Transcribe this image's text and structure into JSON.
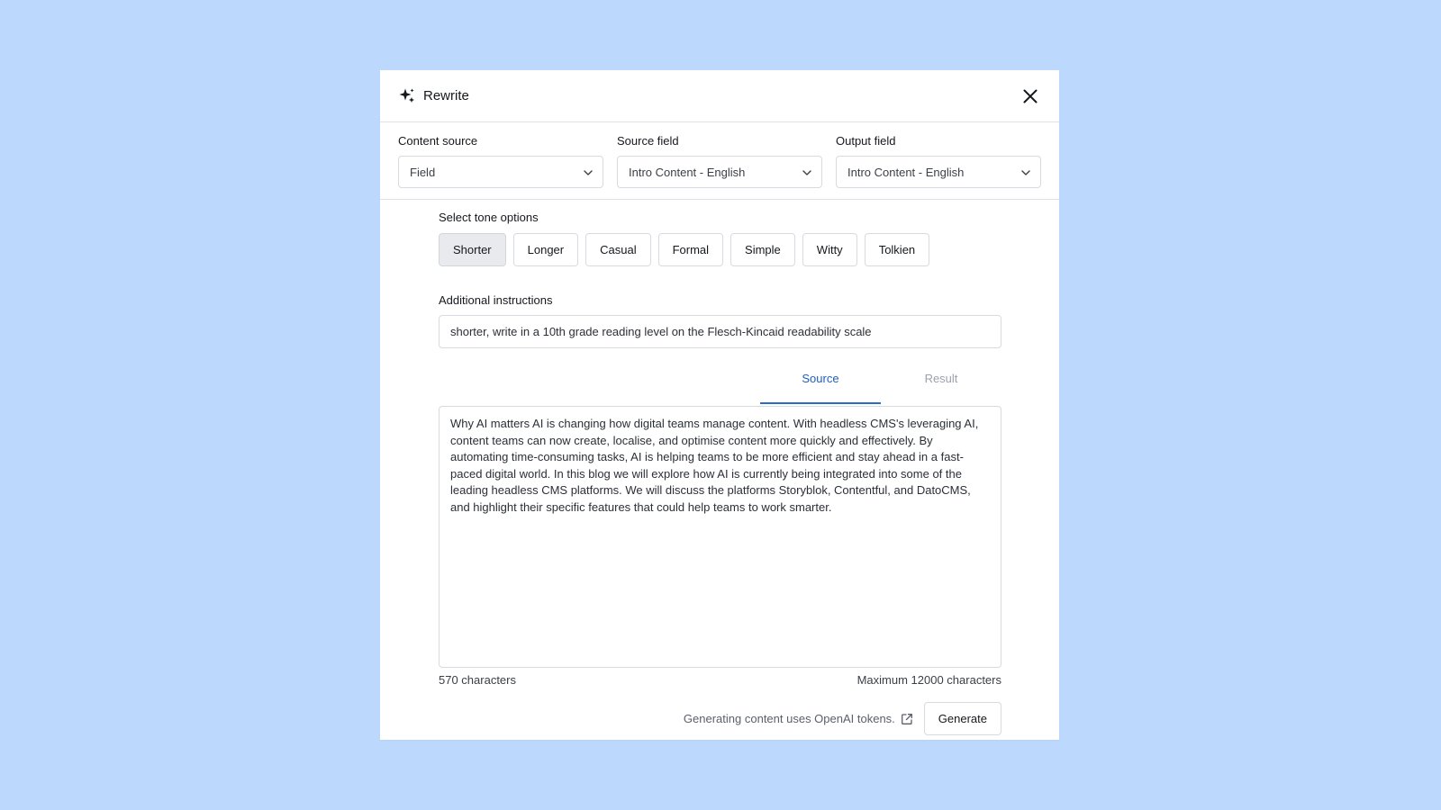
{
  "dialog": {
    "title": "Rewrite",
    "icon": "sparkle-icon",
    "close_icon": "close-icon"
  },
  "fields": {
    "content_source": {
      "label": "Content source",
      "value": "Field"
    },
    "source_field": {
      "label": "Source field",
      "value": "Intro Content - English"
    },
    "output_field": {
      "label": "Output field",
      "value": "Intro Content - English"
    }
  },
  "tones": {
    "label": "Select tone options",
    "options": [
      "Shorter",
      "Longer",
      "Casual",
      "Formal",
      "Simple",
      "Witty",
      "Tolkien"
    ],
    "selected": "Shorter"
  },
  "instructions": {
    "label": "Additional instructions",
    "value": "shorter, write in a 10th grade reading level on the Flesch-Kincaid readability scale"
  },
  "tabs": {
    "source": "Source",
    "result": "Result",
    "active": "Source"
  },
  "content": {
    "text": "Why AI matters AI is changing how digital teams manage content. With headless CMS's leveraging AI, content teams can now create, localise, and optimise content more quickly and effectively. By automating time-consuming tasks, AI is helping teams to be more efficient and stay ahead in a fast-paced digital world. In this blog we will explore how AI is currently being integrated into some of the leading headless CMS platforms. We will discuss the platforms Storyblok, Contentful, and DatoCMS, and highlight their specific features that could help teams to work smarter.",
    "char_count": "570 characters",
    "max_chars": "Maximum 12000 characters"
  },
  "footer": {
    "note": "Generating content uses OpenAI tokens.",
    "note_icon": "external-link-icon",
    "generate_label": "Generate"
  },
  "colors": {
    "background": "#bcd9fd",
    "accent": "#2d6bcb",
    "selected_tone_bg": "#e8eaee"
  }
}
